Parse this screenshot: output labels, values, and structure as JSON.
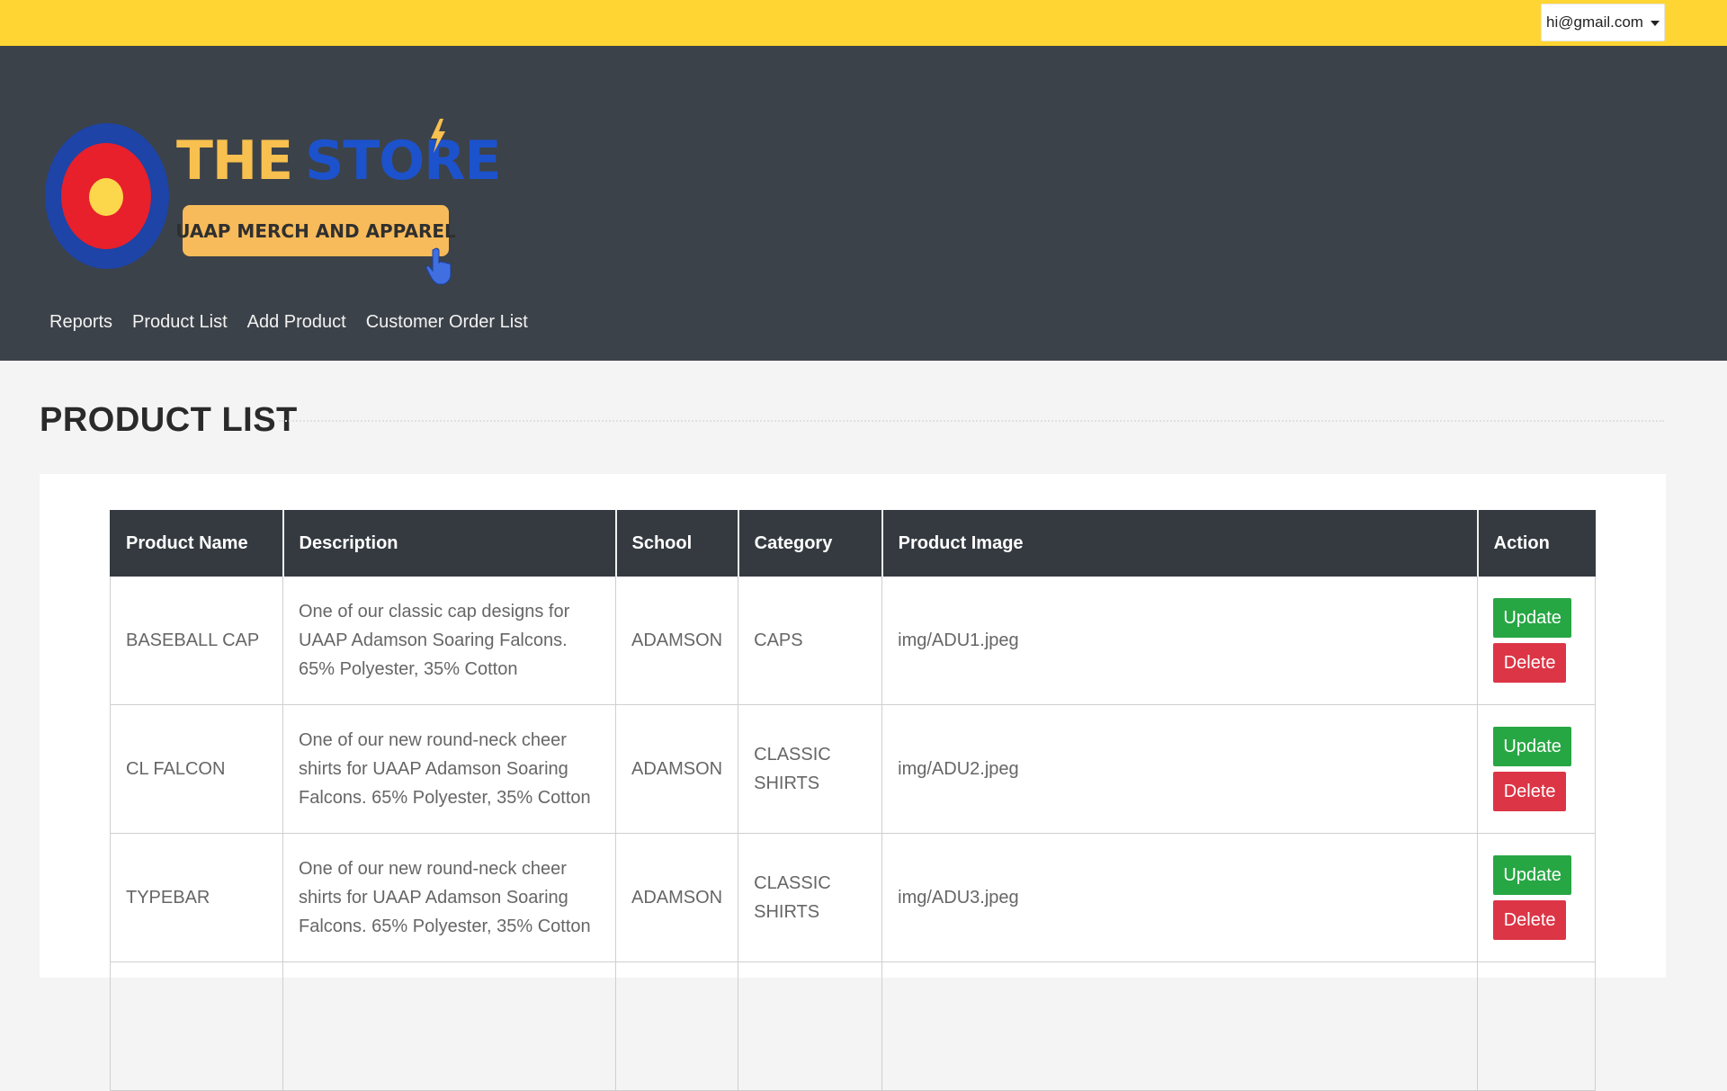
{
  "topbar": {
    "user_email": "hi@gmail.com"
  },
  "logo": {
    "title_word1": "THE",
    "title_word2": "STORE",
    "badge": "UAAP MERCH AND APPAREL",
    "colors": {
      "yellow": "#f7c04f",
      "blue": "#1c52cc",
      "red": "#e7202b"
    }
  },
  "nav": {
    "items": [
      "Reports",
      "Product List",
      "Add Product",
      "Customer Order List"
    ]
  },
  "page": {
    "title": "PRODUCT LIST"
  },
  "table": {
    "headers": [
      "Product Name",
      "Description",
      "School",
      "Category",
      "Product Image",
      "Action"
    ],
    "rows": [
      {
        "name": "BASEBALL CAP",
        "description": "One of our classic cap designs for UAAP Adamson Soaring Falcons. 65% Polyester, 35% Cotton",
        "school": "ADAMSON",
        "category": "CAPS",
        "image": "img/ADU1.jpeg"
      },
      {
        "name": "CL FALCON",
        "description": "One of our new round-neck cheer shirts for UAAP Adamson Soaring Falcons. 65% Polyester, 35% Cotton",
        "school": "ADAMSON",
        "category": "CLASSIC SHIRTS",
        "image": "img/ADU2.jpeg"
      },
      {
        "name": "TYPEBAR",
        "description": "One of our new round-neck cheer shirts for UAAP Adamson Soaring Falcons. 65% Polyester, 35% Cotton",
        "school": "ADAMSON",
        "category": "CLASSIC SHIRTS",
        "image": "img/ADU3.jpeg"
      }
    ],
    "update_label": "Update",
    "delete_label": "Delete"
  },
  "colors": {
    "topbar": "#fed533",
    "header": "#3c4249",
    "table_header": "#343a40",
    "update": "#27a744",
    "delete": "#dc3546"
  }
}
